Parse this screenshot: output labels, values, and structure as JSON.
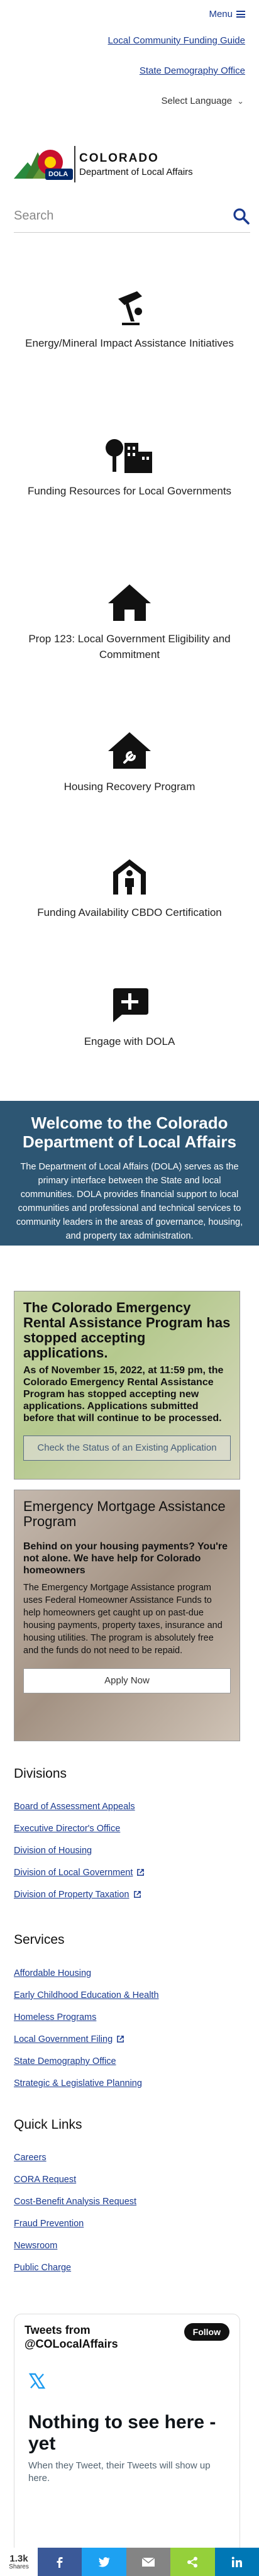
{
  "utility": {
    "menu_label": "Menu",
    "link1": "Local Community Funding Guide",
    "link2": "State Demography Office",
    "language": "Select Language"
  },
  "logo": {
    "title": "COLORADO",
    "subtitle": "Department of Local Affairs",
    "badge": "DOLA"
  },
  "search": {
    "placeholder": "Search"
  },
  "tiles": [
    {
      "label": "Energy/Mineral Impact Assistance Initiatives",
      "icon": "oil-pump-icon"
    },
    {
      "label": "Funding Resources for Local Governments",
      "icon": "tree-buildings-icon"
    },
    {
      "label": "Prop 123: Local Government Eligibility and Commitment",
      "icon": "house-icon"
    },
    {
      "label": "Housing Recovery Program",
      "icon": "house-repair-icon"
    },
    {
      "label": "Funding Availability CBDO Certification",
      "icon": "person-doorway-icon"
    },
    {
      "label": "Engage with DOLA",
      "icon": "chat-plus-icon"
    }
  ],
  "welcome": {
    "title": "Welcome to the Colorado Department of Local Affairs",
    "body": "The Department of Local Affairs (DOLA) serves as the primary interface between the State and local communities. DOLA provides financial support to local communities and professional and technical services to community leaders in the areas of governance, housing, and property tax administration."
  },
  "card1": {
    "title": "The Colorado Emergency Rental Assistance Program has stopped accepting applications.",
    "subtitle": "As of November 15, 2022, at 11:59 pm, the Colorado Emergency Rental Assistance Program has stopped accepting new applications. Applications submitted before that will continue to be processed.",
    "button": "Check the Status of an Existing Application"
  },
  "card2": {
    "title": "Emergency Mortgage Assistance Program",
    "subtitle": "Behind on your housing payments? You're not alone. We have help for Colorado homeowners",
    "body": "The Emergency Mortgage Assistance program uses Federal Homeowner Assistance Funds to help homeowners get caught up on past-due housing payments, property taxes, insurance and housing utilities. The program is absolutely free and the funds do not need to be repaid.",
    "button": "Apply Now"
  },
  "divisions": {
    "heading": "Divisions",
    "items": [
      "Board of Assessment Appeals",
      "Executive Director's Office",
      "Division of Housing",
      "Division of Local Government",
      "Division of Property Taxation"
    ]
  },
  "services": {
    "heading": "Services",
    "items": [
      "Affordable Housing",
      "Early Childhood Education & Health",
      "Homeless Programs",
      "Local Government Filing",
      "State Demography Office",
      "Strategic & Legislative Planning"
    ]
  },
  "quicklinks": {
    "heading": "Quick Links",
    "items": [
      "Careers",
      "CORA Request",
      "Cost-Benefit Analysis Request",
      "Fraud Prevention",
      "Newsroom",
      "Public Charge"
    ]
  },
  "twitter": {
    "title": "Tweets from @COLocalAffairs",
    "follow": "Follow",
    "nothing": "Nothing to see here - yet",
    "sub": "When they Tweet, their Tweets will show up here."
  },
  "share": {
    "count": "1.3k",
    "label": "Shares",
    "colors": {
      "facebook": "#3b5998",
      "twitter": "#1da1f2",
      "email": "#848484",
      "share": "#95d03a",
      "linkedin": "#0077b5"
    }
  },
  "colors": {
    "welcome_bg": "#2d5673",
    "link": "#1a3a8f",
    "brand_red": "#c8102e",
    "brand_blue": "#002868",
    "brand_gold": "#ffd100"
  }
}
